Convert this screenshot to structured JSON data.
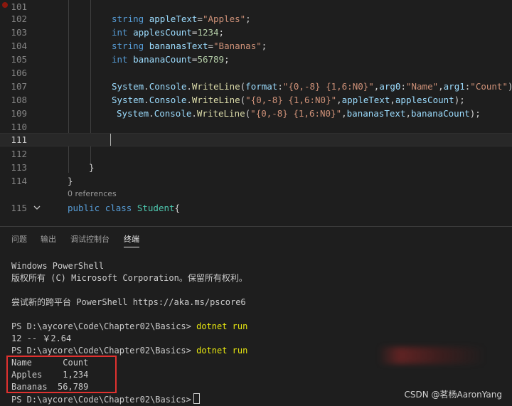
{
  "editor": {
    "lines": [
      {
        "num": "101",
        "code": ""
      },
      {
        "num": "102",
        "code": "string appleText=\"Apples\";"
      },
      {
        "num": "103",
        "code": "int applesCount=1234;"
      },
      {
        "num": "104",
        "code": "string bananasText=\"Bananas\";"
      },
      {
        "num": "105",
        "code": "int bananaCount=56789;"
      },
      {
        "num": "106",
        "code": ""
      },
      {
        "num": "107",
        "code": "System.Console.WriteLine(format:\"{0,-8} {1,6:N0}\",arg0:\"Name\",arg1:\"Count\");"
      },
      {
        "num": "108",
        "code": "System.Console.WriteLine(\"{0,-8} {1,6:N0}\",appleText,applesCount);"
      },
      {
        "num": "109",
        "code": "System.Console.WriteLine(\"{0,-8} {1,6:N0}\",bananasText,bananaCount);"
      },
      {
        "num": "110",
        "code": ""
      },
      {
        "num": "111",
        "code": ""
      },
      {
        "num": "112",
        "code": ""
      },
      {
        "num": "113",
        "code": "}"
      },
      {
        "num": "114",
        "code": "}"
      },
      {
        "num": "115",
        "code": "public class Student{"
      }
    ],
    "codelens": "0 references"
  },
  "panel": {
    "tabs": [
      "问题",
      "输出",
      "调试控制台",
      "终端"
    ],
    "active_tab": "终端"
  },
  "terminal": {
    "lines": [
      "Windows PowerShell",
      "版权所有 (C) Microsoft Corporation。保留所有权利。",
      "",
      "尝试新的跨平台 PowerShell https://aka.ms/pscore6",
      "",
      "PS D:\\aycore\\Code\\Chapter02\\Basics>",
      "12 -- ￥2.64",
      "PS D:\\aycore\\Code\\Chapter02\\Basics>",
      "Name      Count",
      "Apples    1,234",
      "Bananas  56,789",
      "PS D:\\aycore\\Code\\Chapter02\\Basics>"
    ],
    "command": "dotnet run"
  },
  "watermark": "CSDN @茗杨AaronYang"
}
